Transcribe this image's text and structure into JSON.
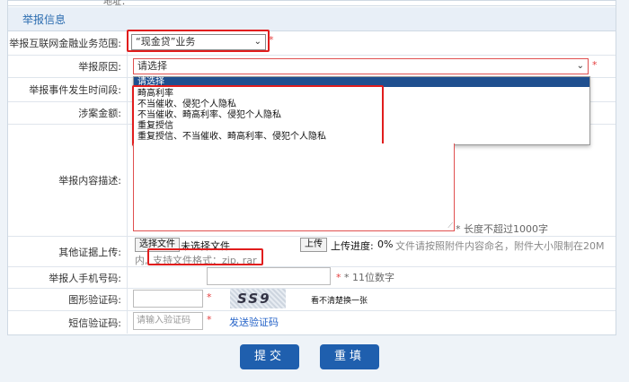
{
  "top_label": "地址：",
  "section_title": "举报信息",
  "rows": {
    "scope_label": "举报互联网金融业务范围:",
    "scope_value": "“现金贷”业务",
    "reason_label": "举报原因:",
    "reason_value": "请选择",
    "time_label": "举报事件发生时间段:",
    "amount_label": "涉案金额:",
    "desc_label": "举报内容描述:",
    "desc_hint": "* 长度不超过1000字",
    "upload_label": "其他证据上传:",
    "choose_file": "选择文件",
    "no_file": "未选择文件",
    "upload_btn": "上传",
    "upload_progress_label": "上传进度:",
    "upload_progress_value": "0%",
    "upload_note_1": "文件请按照附件内容命名，附件大小限制在20M",
    "upload_note_2": "内,",
    "upload_format": "支持文件格式：zip, rar",
    "phone_label": "举报人手机号码:",
    "phone_hint": "* 11位数字",
    "captcha_label": "图形验证码:",
    "captcha_text": "SS9",
    "captcha_refresh": "看不清楚换一张",
    "sms_label": "短信验证码:",
    "sms_placeholder": "请输入验证码",
    "sms_send": "发送验证码"
  },
  "dropdown": {
    "highlighted": "请选择",
    "options": [
      "畸高利率",
      "不当催收、侵犯个人隐私",
      "不当催收、畸高利率、侵犯个人隐私",
      "重复授信",
      "重复授信、不当催收、畸高利率、侵犯个人隐私"
    ]
  },
  "buttons": {
    "submit": "提交",
    "reset": "重填"
  },
  "colors": {
    "accent": "#1f5fae",
    "highlight_box": "#e11d1d",
    "section_bg": "#e8eff7"
  }
}
